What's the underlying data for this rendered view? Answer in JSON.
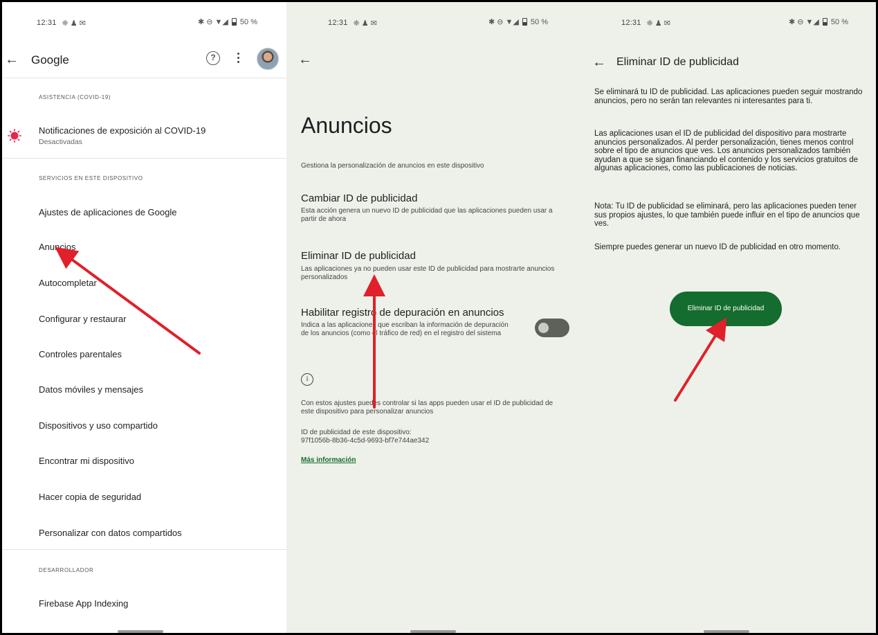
{
  "status_bar": {
    "time": "12:31",
    "left_icons": "❈ ♟ ✉",
    "right_icons": "✱ ⊖ ▼◢",
    "battery": "50 %"
  },
  "panel1": {
    "title": "Google",
    "sections": {
      "asistencia": "ASISTENCIA (COVID-19)",
      "servicios": "SERVICIOS EN ESTE DISPOSITIVO",
      "desarrollador": "DESARROLLADOR"
    },
    "covid": {
      "label": "Notificaciones de exposición al COVID-19",
      "sub": "Desactivadas"
    },
    "items": [
      "Ajustes de aplicaciones de Google",
      "Anuncios",
      "Autocompletar",
      "Configurar y restaurar",
      "Controles parentales",
      "Datos móviles y mensajes",
      "Dispositivos y uso compartido",
      "Encontrar mi dispositivo",
      "Hacer copia de seguridad",
      "Personalizar con datos compartidos"
    ],
    "dev_item": "Firebase App Indexing"
  },
  "panel2": {
    "heading": "Anuncios",
    "intro": "Gestiona la personalización de anuncios en este dispositivo",
    "cambiar_title": "Cambiar ID de publicidad",
    "cambiar_desc": "Esta acción genera un nuevo ID de publicidad que las aplicaciones pueden usar a partir de ahora",
    "eliminar_title": "Eliminar ID de publicidad",
    "eliminar_desc": "Las aplicaciones ya no pueden usar este ID de publicidad para mostrarte anuncios personalizados",
    "debug_title": "Habilitar registro de depuración en anuncios",
    "debug_desc": "Indica a las aplicaciones que escriban la información de depuración de los anuncios (como el tráfico de red) en el registro del sistema",
    "debug_enabled": false,
    "info_text": "Con estos ajustes puedes controlar si las apps pueden usar el ID de publicidad de este dispositivo para personalizar anuncios",
    "device_id_label": "ID de publicidad de este dispositivo:",
    "device_id": "97f1056b-8b36-4c5d-9693-bf7e744ae342",
    "more_link": "Más información"
  },
  "panel3": {
    "title": "Eliminar ID de publicidad",
    "paragraphs": [
      "Se eliminará tu ID de publicidad. Las aplicaciones pueden seguir mostrando anuncios, pero no serán tan relevantes ni interesantes para ti.",
      "Las aplicaciones usan el ID de publicidad del dispositivo para mostrarte anuncios personalizados. Al perder personalización, tienes menos control sobre el tipo de anuncios que ves. Los anuncios personalizados también ayudan a que se sigan financiando el contenido y los servicios gratuitos de algunas aplicaciones, como las publicaciones de noticias.",
      "Nota: Tu ID de publicidad se eliminará, pero las aplicaciones pueden tener sus propios ajustes, lo que también puede influir en el tipo de anuncios que ves.",
      "Siempre puedes generar un nuevo ID de publicidad en otro momento."
    ],
    "button": "Eliminar ID de publicidad"
  },
  "colors": {
    "accent_green": "#146c2e",
    "annotation_red": "#e0202a",
    "panel_bg": "#eef0ea"
  }
}
